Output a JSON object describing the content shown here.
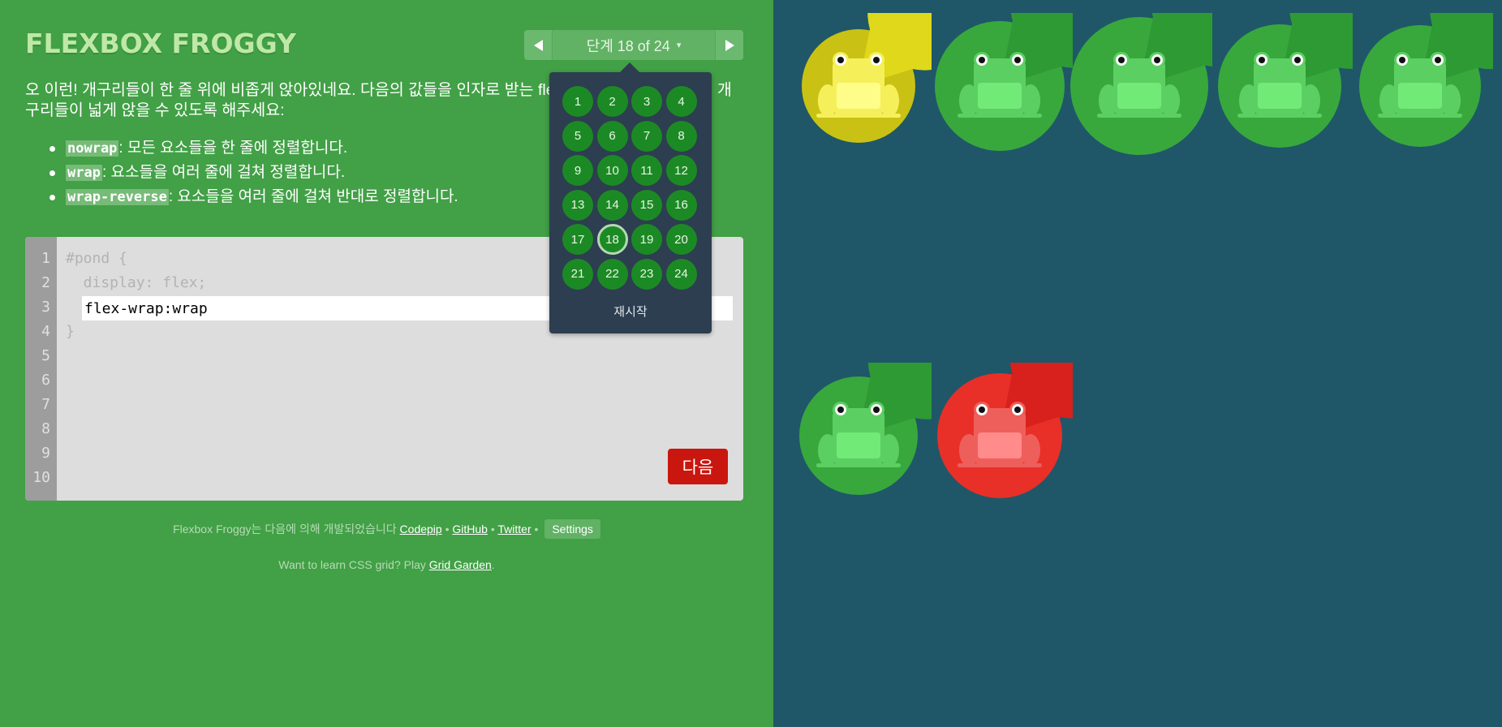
{
  "app": {
    "title": "FLEXBOX FROGGY"
  },
  "level_nav": {
    "label": "단계 18 of 24",
    "caret": "▾",
    "current_level": 18,
    "total_levels": 24,
    "prev_icon": "triangle-left-icon",
    "next_icon": "triangle-right-icon"
  },
  "levels_popup": {
    "levels": [
      "1",
      "2",
      "3",
      "4",
      "5",
      "6",
      "7",
      "8",
      "9",
      "10",
      "11",
      "12",
      "13",
      "14",
      "15",
      "16",
      "17",
      "18",
      "19",
      "20",
      "21",
      "22",
      "23",
      "24"
    ],
    "reset_label": "재시작"
  },
  "instructions": {
    "text": "오 이런! 개구리들이 한 줄 위에 비좁게 앉아있네요. 다음의 값들을 인자로 받는 flex-wrap 속성을 사용하여 개구리들이 넓게 앉을 수 있도록 해주세요:",
    "rules": [
      {
        "keyword": "nowrap",
        "description": ": 모든 요소들을 한 줄에 정렬합니다."
      },
      {
        "keyword": "wrap",
        "description": ": 요소들을 여러 줄에 걸쳐 정렬합니다."
      },
      {
        "keyword": "wrap-reverse",
        "description": ": 요소들을 여러 줄에 걸쳐 반대로 정렬합니다."
      }
    ]
  },
  "editor": {
    "line_numbers": [
      "1",
      "2",
      "3",
      "4",
      "5",
      "6",
      "7",
      "8",
      "9",
      "10"
    ],
    "line1": "#pond {",
    "line2": "  display: flex;",
    "input_value": "flex-wrap:wrap",
    "line4": "}",
    "next_button_label": "다음"
  },
  "footer": {
    "credits_text": "Flexbox Froggy는 다음에 의해 개발되었습니다",
    "links": [
      "Codepip",
      "GitHub",
      "Twitter"
    ],
    "separator": "•",
    "settings_label": "Settings",
    "promo_text": "Want to learn CSS grid? Play",
    "promo_link": "Grid Garden",
    "promo_end": "."
  },
  "pond": {
    "frogs": [
      {
        "color": "yellow"
      },
      {
        "color": "green"
      },
      {
        "color": "green"
      },
      {
        "color": "green"
      },
      {
        "color": "green"
      },
      {
        "color": "green"
      },
      {
        "color": "red"
      }
    ]
  },
  "colors": {
    "sidebar_bg": "#42a046",
    "pond_bg": "#1f5768",
    "level_popup_bg": "#2c3e50",
    "level_button": "#1c8a24",
    "next_button": "#c9160e",
    "frog_green": "#6fe875",
    "frog_yellow": "#f7f43c",
    "frog_red": "#f05a5a"
  }
}
